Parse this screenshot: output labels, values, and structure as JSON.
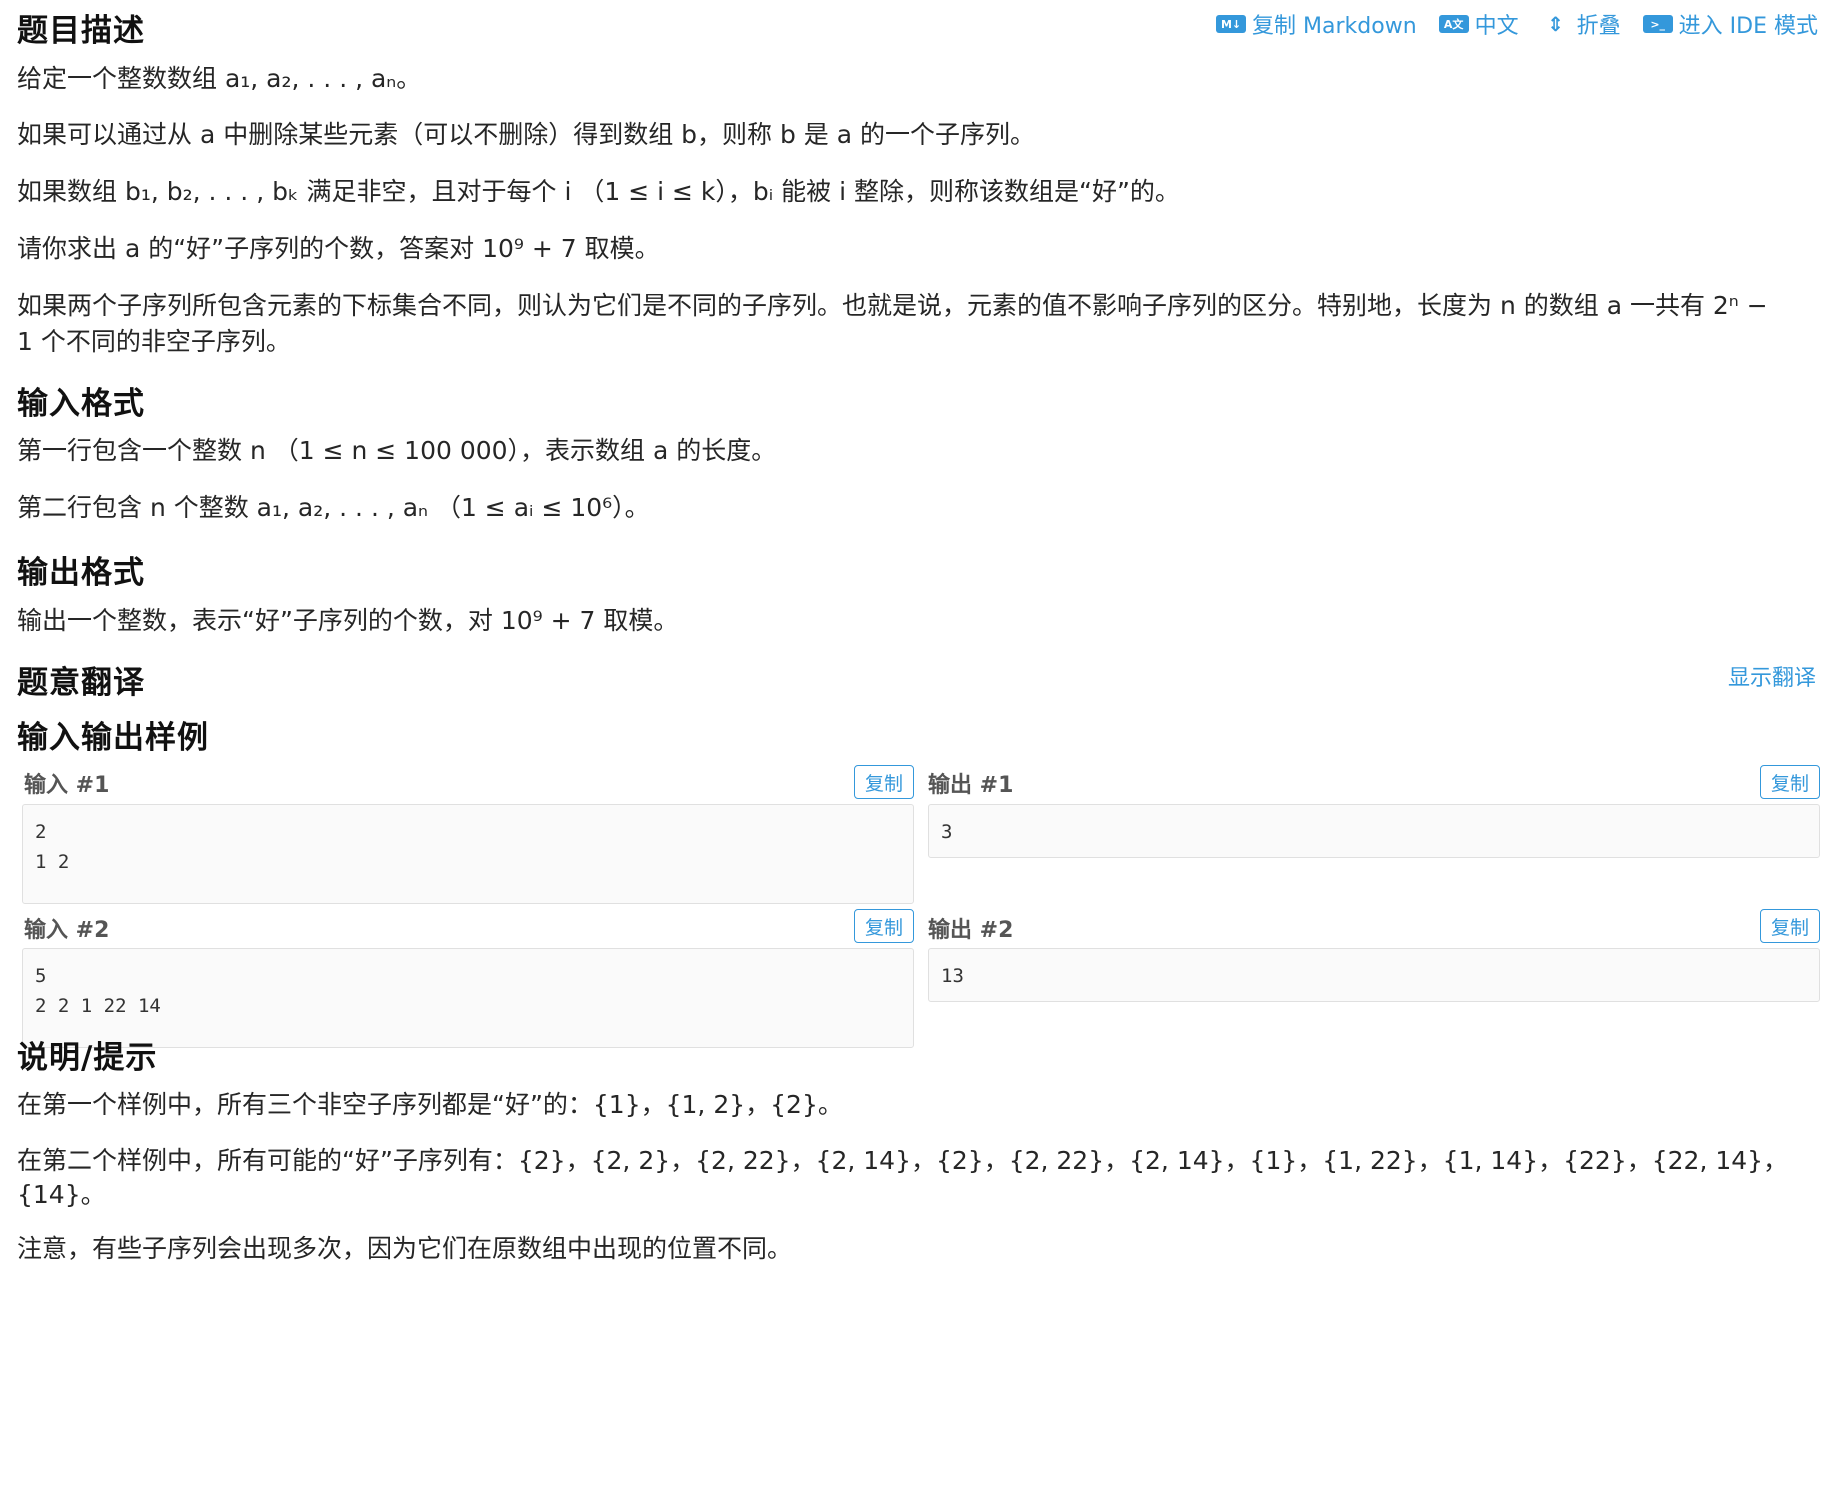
{
  "toolbar": {
    "copy_markdown": "复制 Markdown",
    "copy_markdown_icon": "M↓",
    "lang": "中文",
    "lang_icon": "A文",
    "fold": "折叠",
    "fold_icon": "⇕",
    "ide": "进入 IDE 模式",
    "ide_icon": ">_"
  },
  "description": {
    "heading": "题目描述",
    "p1": "给定一个整数数组 a₁, a₂, . . . , aₙ。",
    "p2": "如果可以通过从 a 中删除某些元素（可以不删除）得到数组 b，则称 b 是 a 的一个子序列。",
    "p3": "如果数组 b₁, b₂, . . . , bₖ 满足非空，且对于每个 i （1 ≤ i ≤ k），bᵢ 能被 i 整除，则称该数组是“好”的。",
    "p4": "请你求出 a 的“好”子序列的个数，答案对 10⁹ + 7 取模。",
    "p5a": "如果两个子序列所包含元素的下标集合不同，则认为它们是不同的子序列。也就是说，元素的值不影响子序列的区分。特别地，长度为 n 的数组 a 一共有 2ⁿ −",
    "p5b": "1 个不同的非空子序列。"
  },
  "input_format": {
    "heading": "输入格式",
    "p1": "第一行包含一个整数 n （1 ≤ n ≤ 100 000），表示数组 a 的长度。",
    "p2": "第二行包含 n 个整数 a₁, a₂, . . . , aₙ （1 ≤ aᵢ ≤ 10⁶）。"
  },
  "output_format": {
    "heading": "输出格式",
    "p1": "输出一个整数，表示“好”子序列的个数，对 10⁹ + 7 取模。"
  },
  "translation": {
    "heading": "题意翻译",
    "show": "显示翻译"
  },
  "samples": {
    "heading": "输入输出样例",
    "copy": "复制",
    "items": [
      {
        "in_label": "输入 #1",
        "out_label": "输出 #1",
        "input": "2\n1 2",
        "output": "3"
      },
      {
        "in_label": "输入 #2",
        "out_label": "输出 #2",
        "input": "5\n2 2 1 22 14",
        "output": "13"
      }
    ]
  },
  "hint": {
    "heading": "说明/提示",
    "p1": "在第一个样例中，所有三个非空子序列都是“好”的：{1}，{1, 2}，{2}。",
    "p2a": "在第二个样例中，所有可能的“好”子序列有：{2}，{2, 2}，{2, 22}，{2, 14}，{2}，{2, 22}，{2, 14}，{1}，{1, 22}，{1, 14}，{22}，{22, 14}，",
    "p2b": "{14}。",
    "p3": "注意，有些子序列会出现多次，因为它们在原数组中出现的位置不同。"
  }
}
